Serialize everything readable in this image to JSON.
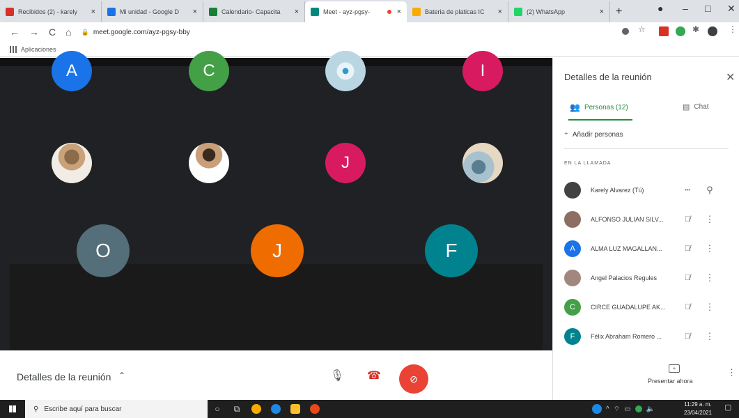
{
  "browser": {
    "tabs": [
      {
        "title": "Recibidos (2) - karely",
        "icon": "gmail-icon",
        "color": "#d93025",
        "active": false
      },
      {
        "title": "Mi unidad - Google D",
        "icon": "drive-icon",
        "color": "#1a73e8",
        "active": false
      },
      {
        "title": "Calendario- Capacita",
        "icon": "sheets-icon",
        "color": "#188038",
        "active": false
      },
      {
        "title": "Meet - ayz-pgsy-",
        "icon": "meet-icon",
        "color": "#00897b",
        "active": true,
        "recording": true
      },
      {
        "title": "Bateria de platicas IC",
        "icon": "drive-icon",
        "color": "#f9ab00",
        "active": false
      },
      {
        "title": "(2) WhatsApp",
        "icon": "whatsapp-icon",
        "color": "#25d366",
        "active": false
      }
    ],
    "url": "meet.google.com/ayz-pgsy-bby",
    "bookmarks_label": "Aplicaciones"
  },
  "meeting": {
    "tiles": [
      {
        "letter": "A",
        "color": "#1a73e8",
        "kind": "letter"
      },
      {
        "letter": "C",
        "color": "#43a047",
        "kind": "letter"
      },
      {
        "letter": "",
        "color": "",
        "kind": "disc"
      },
      {
        "letter": "I",
        "color": "#d81b60",
        "kind": "letter"
      },
      {
        "letter": "",
        "color": "",
        "kind": "photo"
      },
      {
        "letter": "",
        "color": "",
        "kind": "photo2"
      },
      {
        "letter": "J",
        "color": "#d81b60",
        "kind": "letter"
      },
      {
        "letter": "",
        "color": "",
        "kind": "photo3"
      },
      {
        "letter": "O",
        "color": "#546e7a",
        "kind": "letter"
      },
      {
        "letter": "J",
        "color": "#ef6c00",
        "kind": "letter"
      },
      {
        "letter": "F",
        "color": "#00838f",
        "kind": "letter"
      }
    ],
    "details_label": "Detalles de la reunión"
  },
  "panel": {
    "title": "Detalles de la reunión",
    "tab_people": "Personas (12)",
    "tab_chat": "Chat",
    "add_people": "Añadir personas",
    "section_label": "EN LA LLAMADA",
    "participants": [
      {
        "name": "Karely Alvarez (Tú)",
        "avatar": "photo",
        "letter": "",
        "color": "#424242",
        "status": "dots"
      },
      {
        "name": "ALFONSO JULIAN SILV...",
        "avatar": "photo",
        "letter": "",
        "color": "#8d6e63",
        "status": "muted"
      },
      {
        "name": "ALMA LUZ MAGALLAN...",
        "avatar": "letter",
        "letter": "A",
        "color": "#1a73e8",
        "status": "muted"
      },
      {
        "name": "Angel Palacios Regules",
        "avatar": "photo",
        "letter": "",
        "color": "#a1887f",
        "status": "muted"
      },
      {
        "name": "CIRCE GUADALUPE AK...",
        "avatar": "letter",
        "letter": "C",
        "color": "#43a047",
        "status": "muted"
      },
      {
        "name": "Félix Abraham Romero ...",
        "avatar": "letter",
        "letter": "F",
        "color": "#00838f",
        "status": "muted"
      }
    ],
    "present_label": "Presentar ahora"
  },
  "taskbar": {
    "search_placeholder": "Escribe aquí para buscar",
    "time": "11:29 a. m.",
    "date": "23/04/2021"
  }
}
